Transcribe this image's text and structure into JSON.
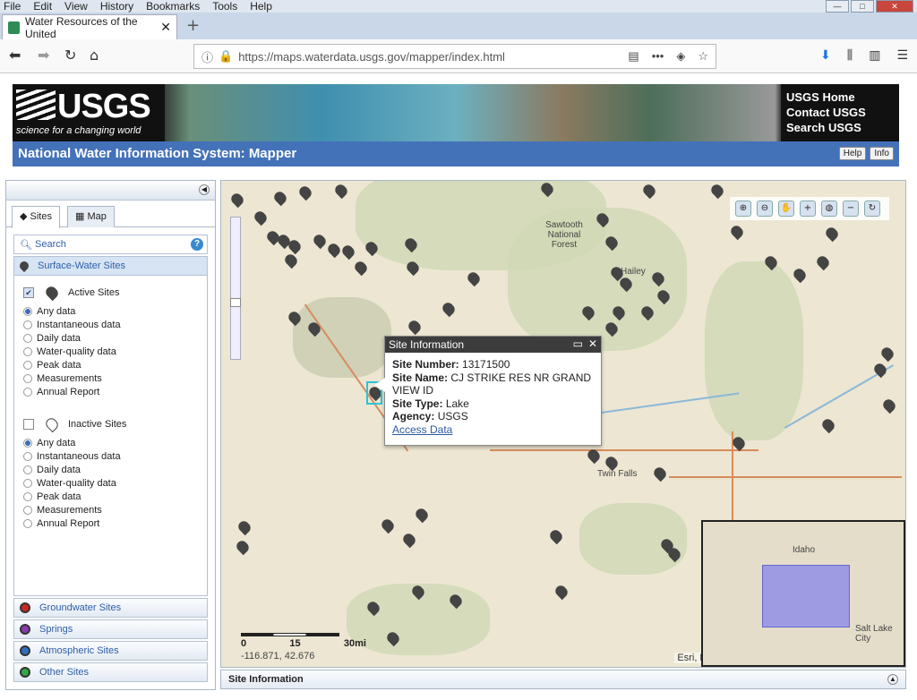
{
  "browser": {
    "menu": [
      "File",
      "Edit",
      "View",
      "History",
      "Bookmarks",
      "Tools",
      "Help"
    ],
    "tab_title": "Water Resources of the United",
    "url": "https://maps.waterdata.usgs.gov/mapper/index.html"
  },
  "banner": {
    "logo": "USGS",
    "tagline": "science for a changing world",
    "links": [
      "USGS Home",
      "Contact USGS",
      "Search USGS"
    ],
    "title": "National Water Information System: Mapper",
    "help_btn": "Help",
    "info_btn": "Info"
  },
  "left_panel": {
    "tabs": [
      "Sites",
      "Map"
    ],
    "search_label": "Search",
    "surface_title": "Surface-Water Sites",
    "active_label": "Active Sites",
    "inactive_label": "Inactive Sites",
    "options": [
      "Any data",
      "Instantaneous data",
      "Daily data",
      "Water-quality data",
      "Peak data",
      "Measurements",
      "Annual Report"
    ],
    "other_groups": [
      {
        "label": "Groundwater Sites",
        "color": "#c8281e"
      },
      {
        "label": "Springs",
        "color": "#8a3bb0"
      },
      {
        "label": "Atmospheric Sites",
        "color": "#2c6fc2"
      },
      {
        "label": "Other Sites",
        "color": "#2fa84a"
      }
    ]
  },
  "map": {
    "labels": [
      "Sawtooth National Forest",
      "Hailey",
      "Twin Falls",
      "Idaho",
      "Salt Lake City"
    ],
    "scale": [
      "0",
      "15",
      "30mi"
    ],
    "coords": "-116.871, 42.676",
    "attribution": "Esri, HERE"
  },
  "popup": {
    "title": "Site Information",
    "site_number_label": "Site Number:",
    "site_number": "13171500",
    "site_name_label": "Site Name:",
    "site_name": "CJ STRIKE RES NR GRAND VIEW ID",
    "site_type_label": "Site Type:",
    "site_type": "Lake",
    "agency_label": "Agency:",
    "agency": "USGS",
    "access_link": "Access Data"
  },
  "bottom_panel": {
    "title": "Site Information"
  }
}
